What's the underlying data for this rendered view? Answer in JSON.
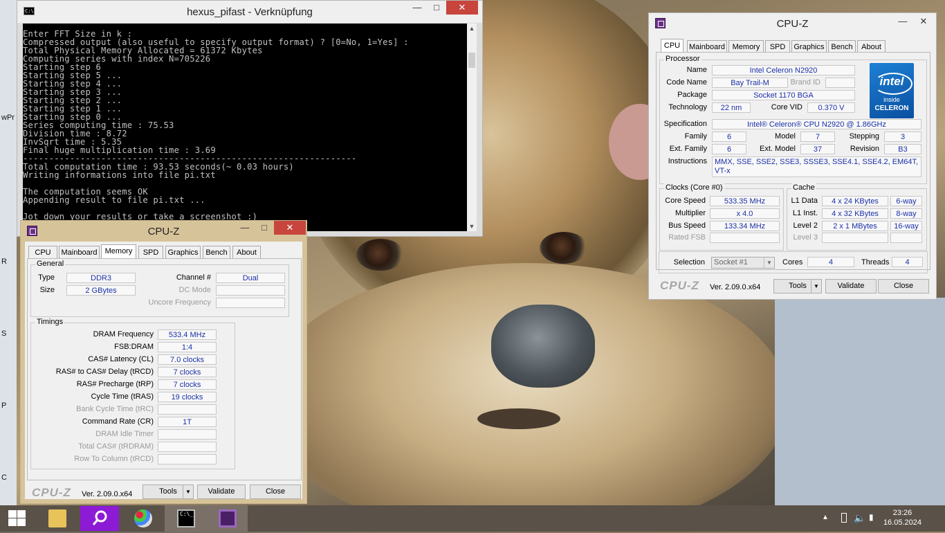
{
  "desktop": {
    "side_labels": [
      "wPr",
      "R",
      "S",
      "P",
      "C"
    ]
  },
  "console": {
    "title": "hexus_pifast - Verknüpfung",
    "icon_text": "C:\\",
    "lines": [
      "Enter FFT Size in k :",
      "Compressed output (also useful to specify output format) ? [0=No, 1=Yes] :",
      "Total Physical Memory Allocated = 61372 Kbytes",
      "Computing series with index N=705226",
      "Starting step 6",
      "Starting step 5 ...",
      "Starting step 4 ...",
      "Starting step 3 ...",
      "Starting step 2 ...",
      "Starting step 1 ...",
      "Starting step 0 ...",
      "Series computing time : 75.53",
      "Division time : 8.72",
      "InvSqrt time : 5.35",
      "Final huge multiplication time : 3.69",
      "----------------------------------------------------------------",
      "Total computation time : 93.53 seconds(~ 0.03 hours)",
      "Writing informations into file pi.txt",
      "",
      "The computation seems OK",
      "Appending result to file pi.txt ...",
      "",
      "Jot down your results or take a screenshot :)"
    ]
  },
  "cpuz_cpu": {
    "title": "CPU-Z",
    "tabs": [
      "CPU",
      "Mainboard",
      "Memory",
      "SPD",
      "Graphics",
      "Bench",
      "About"
    ],
    "active_tab": "CPU",
    "processor": {
      "group": "Processor",
      "name_label": "Name",
      "name": "Intel Celeron N2920",
      "codename_label": "Code Name",
      "codename": "Bay Trail-M",
      "brandid_label": "Brand ID",
      "brandid": "",
      "package_label": "Package",
      "package": "Socket 1170 BGA",
      "technology_label": "Technology",
      "technology": "22 nm",
      "corevid_label": "Core VID",
      "corevid": "0.370 V",
      "spec_label": "Specification",
      "spec": "Intel® Celeron® CPU  N2920  @ 1.86GHz",
      "family_label": "Family",
      "family": "6",
      "model_label": "Model",
      "model": "7",
      "stepping_label": "Stepping",
      "stepping": "3",
      "extfamily_label": "Ext. Family",
      "extfamily": "6",
      "extmodel_label": "Ext. Model",
      "extmodel": "37",
      "revision_label": "Revision",
      "revision": "B3",
      "instructions_label": "Instructions",
      "instructions": "MMX, SSE, SSE2, SSE3, SSSE3, SSE4.1, SSE4.2, EM64T, VT-x"
    },
    "intel_logo": {
      "brand": "intel",
      "inside": "inside",
      "product": "CELERON"
    },
    "clocks": {
      "group": "Clocks (Core #0)",
      "corespeed_label": "Core Speed",
      "corespeed": "533.35 MHz",
      "multiplier_label": "Multiplier",
      "multiplier": "x 4.0",
      "busspeed_label": "Bus Speed",
      "busspeed": "133.34 MHz",
      "ratedfsb_label": "Rated FSB",
      "ratedfsb": ""
    },
    "cache": {
      "group": "Cache",
      "l1data_label": "L1 Data",
      "l1data": "4 x 24 KBytes",
      "l1data_way": "6-way",
      "l1inst_label": "L1 Inst.",
      "l1inst": "4 x 32 KBytes",
      "l1inst_way": "8-way",
      "level2_label": "Level 2",
      "level2": "2 x 1 MBytes",
      "level2_way": "16-way",
      "level3_label": "Level 3",
      "level3": "",
      "level3_way": ""
    },
    "selection_label": "Selection",
    "selection": "Socket #1",
    "cores_label": "Cores",
    "cores": "4",
    "threads_label": "Threads",
    "threads": "4",
    "footer": {
      "logo": "CPU-Z",
      "version": "Ver. 2.09.0.x64",
      "tools": "Tools",
      "validate": "Validate",
      "close": "Close"
    }
  },
  "cpuz_mem": {
    "title": "CPU-Z",
    "tabs": [
      "CPU",
      "Mainboard",
      "Memory",
      "SPD",
      "Graphics",
      "Bench",
      "About"
    ],
    "active_tab": "Memory",
    "general": {
      "group": "General",
      "type_label": "Type",
      "type": "DDR3",
      "size_label": "Size",
      "size": "2 GBytes",
      "channel_label": "Channel #",
      "channel": "Dual",
      "dcmode_label": "DC Mode",
      "dcmode": "",
      "uncore_label": "Uncore Frequency",
      "uncore": ""
    },
    "timings": {
      "group": "Timings",
      "rows": [
        {
          "label": "DRAM Frequency",
          "value": "533.4 MHz",
          "dim": false
        },
        {
          "label": "FSB:DRAM",
          "value": "1:4",
          "dim": false
        },
        {
          "label": "CAS# Latency (CL)",
          "value": "7.0 clocks",
          "dim": false
        },
        {
          "label": "RAS# to CAS# Delay (tRCD)",
          "value": "7 clocks",
          "dim": false
        },
        {
          "label": "RAS# Precharge (tRP)",
          "value": "7 clocks",
          "dim": false
        },
        {
          "label": "Cycle Time (tRAS)",
          "value": "19 clocks",
          "dim": false
        },
        {
          "label": "Bank Cycle Time (tRC)",
          "value": "",
          "dim": true
        },
        {
          "label": "Command Rate (CR)",
          "value": "1T",
          "dim": false
        },
        {
          "label": "DRAM Idle Timer",
          "value": "",
          "dim": true
        },
        {
          "label": "Total CAS# (tRDRAM)",
          "value": "",
          "dim": true
        },
        {
          "label": "Row To Column (tRCD)",
          "value": "",
          "dim": true
        }
      ]
    },
    "footer": {
      "logo": "CPU-Z",
      "version": "Ver. 2.09.0.x64",
      "tools": "Tools",
      "validate": "Validate",
      "close": "Close"
    }
  },
  "taskbar": {
    "time": "23:26",
    "date": "16.05.2024",
    "items": [
      "start",
      "file-explorer",
      "search-app",
      "paint",
      "command-prompt",
      "cpu-z"
    ]
  }
}
